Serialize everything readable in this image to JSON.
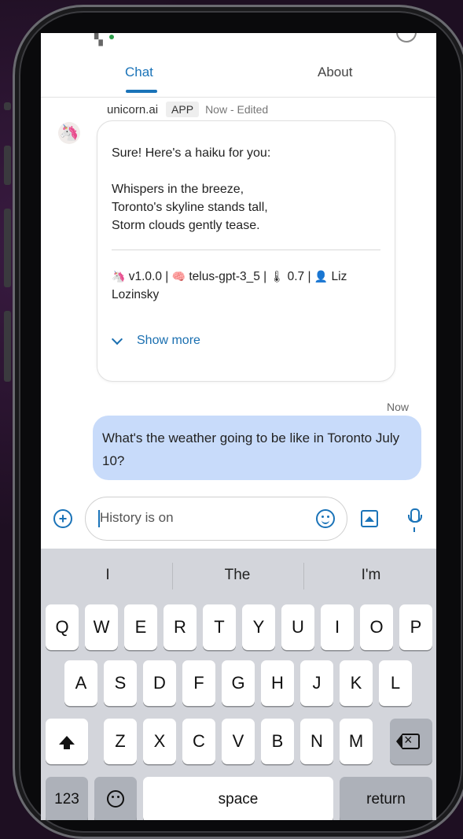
{
  "tabs": {
    "chat": "Chat",
    "about": "About"
  },
  "bot_message": {
    "sender": "unicorn.ai",
    "badge": "APP",
    "time": "Now - Edited",
    "intro": "Sure! Here's a haiku for you:",
    "haiku": [
      "Whispers in the breeze,",
      "Toronto's skyline stands tall,",
      "Storm clouds gently tease."
    ],
    "meta_line1": "v1.0.0 |",
    "model": "telus-gpt-3_5 |",
    "temperature": "0.7 |",
    "author_line": "Liz",
    "author_line2": "Lozinsky",
    "show_more": "Show more",
    "meta_icons": [
      "unicorn-icon",
      "brain-icon",
      "thermometer-icon",
      "person-icon"
    ]
  },
  "user_message": {
    "time": "Now",
    "text": "What's the weather going to be like in Toronto July 10?"
  },
  "input": {
    "placeholder": "History is on"
  },
  "keyboard": {
    "suggestions": [
      "I",
      "The",
      "I'm"
    ],
    "row1": [
      "Q",
      "W",
      "E",
      "R",
      "T",
      "Y",
      "U",
      "I",
      "O",
      "P"
    ],
    "row2": [
      "A",
      "S",
      "D",
      "F",
      "G",
      "H",
      "J",
      "K",
      "L"
    ],
    "row3": [
      "Z",
      "X",
      "C",
      "V",
      "B",
      "N",
      "M"
    ],
    "numbers_key": "123",
    "space_key": "space",
    "return_key": "return"
  },
  "colors": {
    "accent": "#1a73b8",
    "user_bubble": "#c8dbfa",
    "keyboard_bg": "#d3d5db"
  }
}
